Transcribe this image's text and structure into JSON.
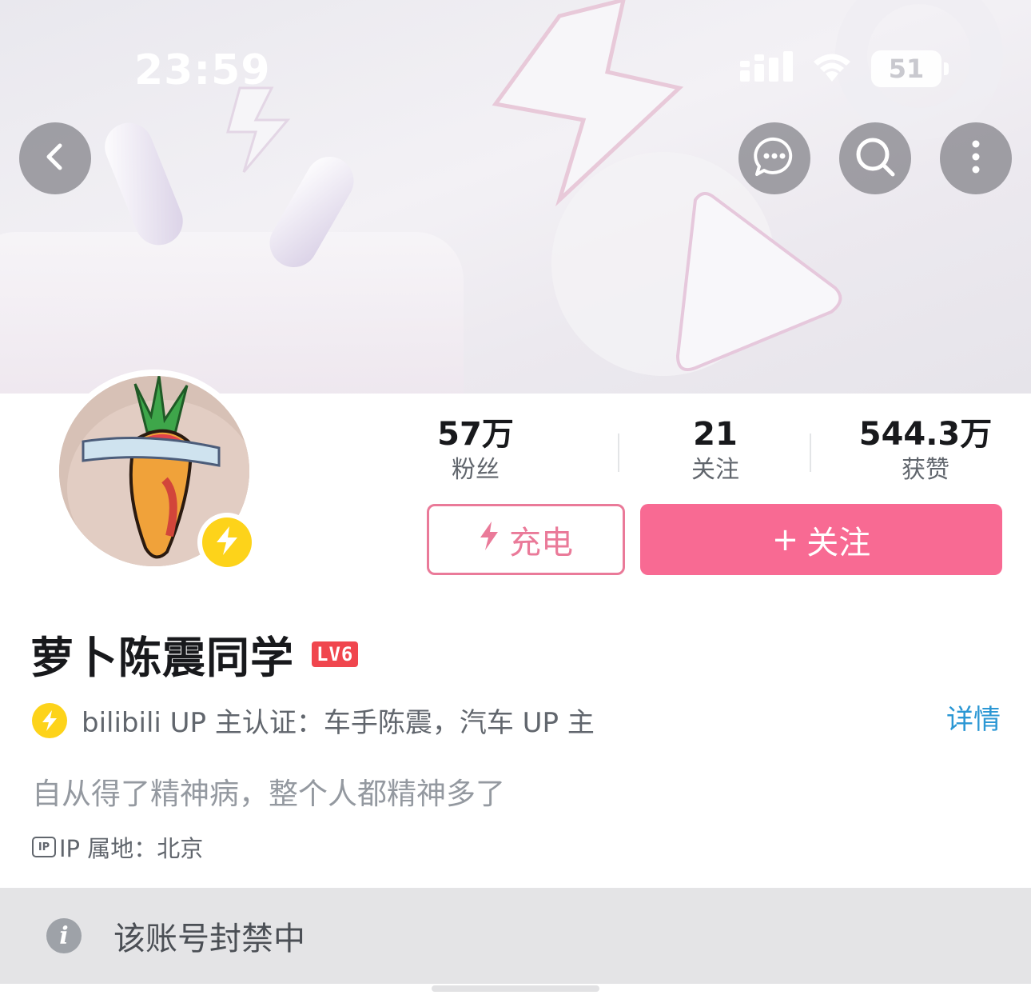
{
  "status_bar": {
    "time": "23:59",
    "battery": "51",
    "icons": [
      "cellular-signal-icon",
      "wifi-icon",
      "battery-icon"
    ]
  },
  "header": {
    "buttons": [
      "back-icon",
      "message-bubble-icon",
      "search-icon",
      "more-vertical-icon"
    ]
  },
  "stats": [
    {
      "value": "57万",
      "label": "粉丝"
    },
    {
      "value": "21",
      "label": "关注"
    },
    {
      "value": "544.3万",
      "label": "获赞"
    }
  ],
  "actions": {
    "charge_label": "充电",
    "follow_label": "关注",
    "follow_prefix": "+"
  },
  "profile": {
    "username": "萝卜陈震同学",
    "level": "LV6",
    "certification": "bilibili UP 主认证：车手陈震，汽车 UP 主",
    "details_link": "详情",
    "bio": "自从得了精神病，整个人都精神多了",
    "ip_icon_text": "IP",
    "ip_location": "IP 属地：北京"
  },
  "notice": {
    "text": "该账号封禁中"
  },
  "colors": {
    "accent_pink": "#f86a93",
    "charge_pink": "#ea7a99",
    "link_blue": "#2b97d4",
    "level_red": "#f0464e",
    "badge_yellow": "#fdd31a"
  }
}
